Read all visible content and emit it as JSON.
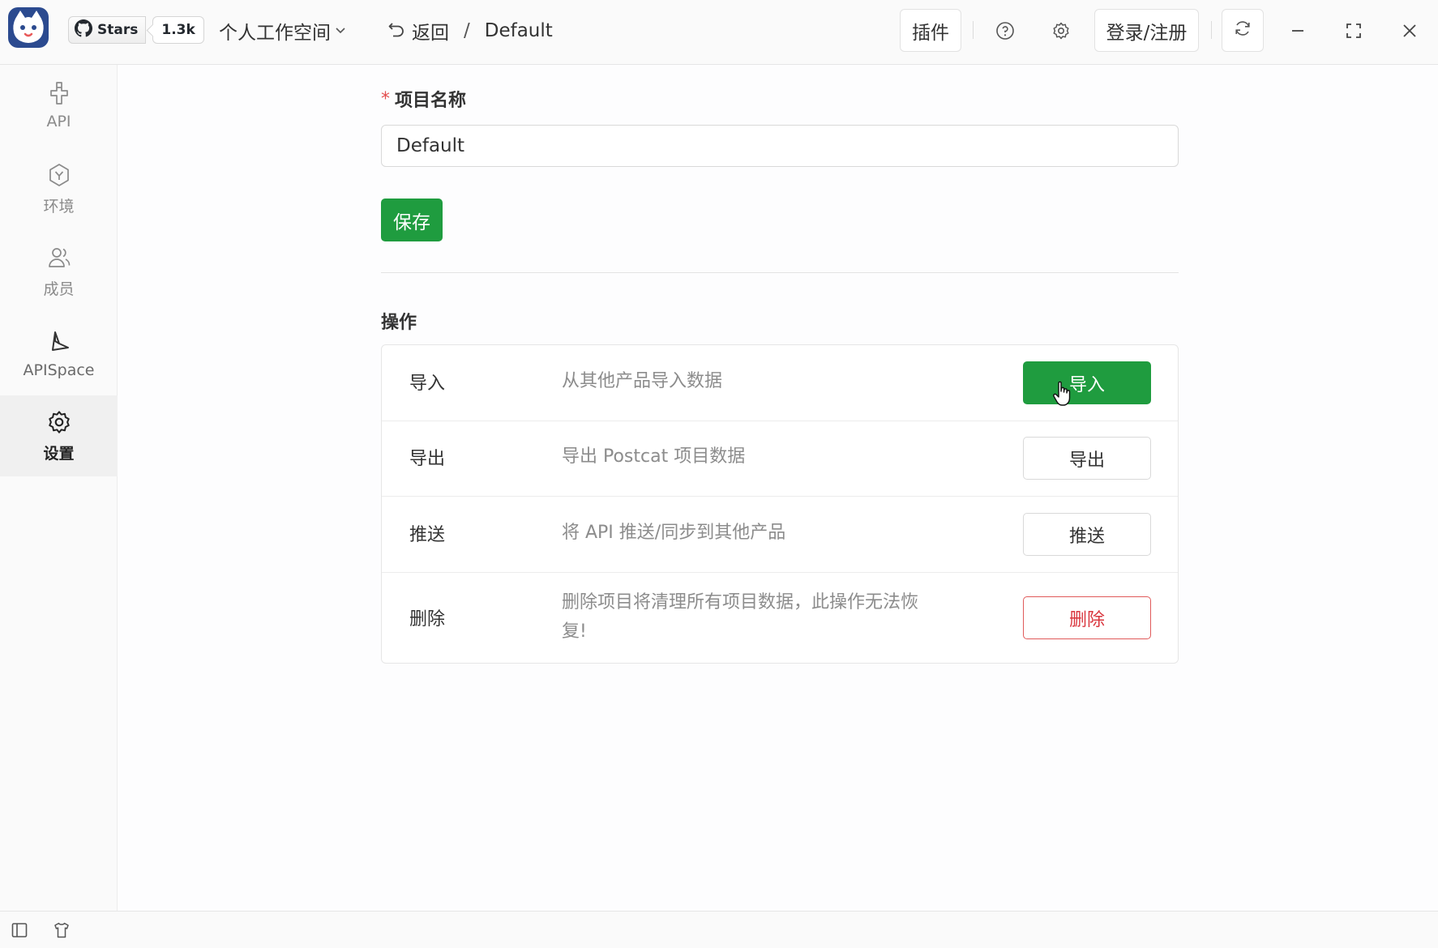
{
  "header": {
    "github": {
      "stars_label": "Stars",
      "count": "1.3k"
    },
    "workspace": "个人工作空间",
    "back_label": "返回",
    "breadcrumb_sep": "/",
    "project": "Default",
    "plugin_label": "插件",
    "login_label": "登录/注册",
    "icons": [
      "github-icon",
      "chevron-down-icon",
      "undo-icon",
      "help-icon",
      "settings-icon",
      "refresh-icon",
      "minimize-icon",
      "maximize-icon",
      "close-icon"
    ]
  },
  "sidebar": {
    "items": [
      {
        "label": "API",
        "icon": "api-icon",
        "active": false
      },
      {
        "label": "环境",
        "icon": "environment-icon",
        "active": false
      },
      {
        "label": "成员",
        "icon": "members-icon",
        "active": false
      },
      {
        "label": "APISpace",
        "icon": "apispace-icon",
        "active": false
      },
      {
        "label": "设置",
        "icon": "gear-icon",
        "active": true
      }
    ]
  },
  "form": {
    "required_mark": "*",
    "name_label": "项目名称",
    "name_value": "Default",
    "save_label": "保存"
  },
  "operations": {
    "title": "操作",
    "rows": [
      {
        "name": "导入",
        "desc": "从其他产品导入数据",
        "button": "导入",
        "style": "primary"
      },
      {
        "name": "导出",
        "desc": "导出 Postcat 项目数据",
        "button": "导出",
        "style": "default"
      },
      {
        "name": "推送",
        "desc": "将 API 推送/同步到其他产品",
        "button": "推送",
        "style": "default"
      },
      {
        "name": "删除",
        "desc": "删除项目将清理所有项目数据，此操作无法恢复!",
        "button": "删除",
        "style": "danger"
      }
    ]
  },
  "footer": {
    "icons": [
      "sidebar-toggle-icon",
      "theme-icon"
    ]
  },
  "colors": {
    "primary": "#1f9c3f",
    "danger": "#d9363e",
    "required": "#e34d4d"
  }
}
